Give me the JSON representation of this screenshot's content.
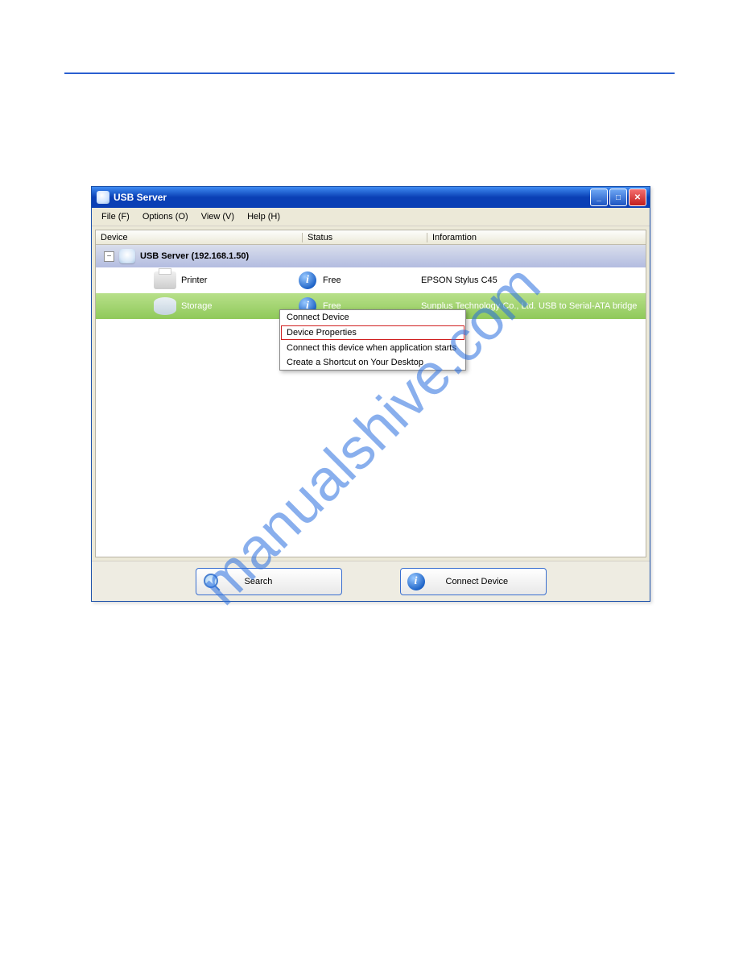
{
  "watermark": "manualshive.com",
  "window": {
    "title": "USB Server",
    "menus": [
      "File (F)",
      "Options (O)",
      "View (V)",
      "Help (H)"
    ],
    "columns": {
      "device": "Device",
      "status": "Status",
      "info": "Inforamtion"
    },
    "server_label": "USB Server  (192.168.1.50)",
    "tree_toggle": "−",
    "devices": [
      {
        "name": "Printer",
        "status": "Free",
        "info": "EPSON Stylus C45",
        "selected": false,
        "icon": "printer"
      },
      {
        "name": "Storage",
        "status": "Free",
        "info": "Sunplus Technology Co., Ltd. USB to Serial-ATA bridge",
        "selected": true,
        "icon": "storage"
      }
    ],
    "context_menu": {
      "items": [
        "Connect Device",
        "Device Properties",
        "Connect this device when application starts",
        "Create a Shortcut on Your Desktop"
      ],
      "highlighted_index": 1
    },
    "buttons": {
      "search": "Search",
      "connect": "Connect Device"
    },
    "info_glyph": "i"
  }
}
